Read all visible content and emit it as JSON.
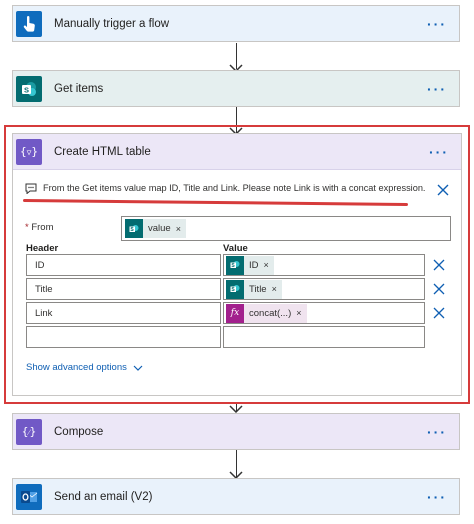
{
  "steps": {
    "trigger": {
      "title": "Manually trigger a flow",
      "more": "···"
    },
    "get_items": {
      "title": "Get items",
      "more": "···"
    },
    "compose": {
      "title": "Compose",
      "more": "···"
    },
    "send_email": {
      "title": "Send an email (V2)",
      "more": "···"
    }
  },
  "html_table": {
    "title": "Create HTML table",
    "more": "···",
    "note": "From the Get items value map ID, Title and Link. Please note Link is with a concat expression.",
    "from_label": "From",
    "from_required": "*",
    "from_token": "value",
    "header_col": "Header",
    "value_col": "Value",
    "rows": [
      {
        "header": "ID",
        "value": "ID"
      },
      {
        "header": "Title",
        "value": "Title"
      },
      {
        "header": "Link",
        "value": "concat(...)"
      }
    ],
    "show_advanced": "Show advanced options",
    "token_remove": "×"
  },
  "colors": {
    "trigger": "#0f6cbd",
    "sharepoint": "#036c70",
    "data_op": "#7159c6",
    "outlook": "#0f6cbd",
    "highlight": "#d63b3b",
    "expression": "#a2208d"
  }
}
